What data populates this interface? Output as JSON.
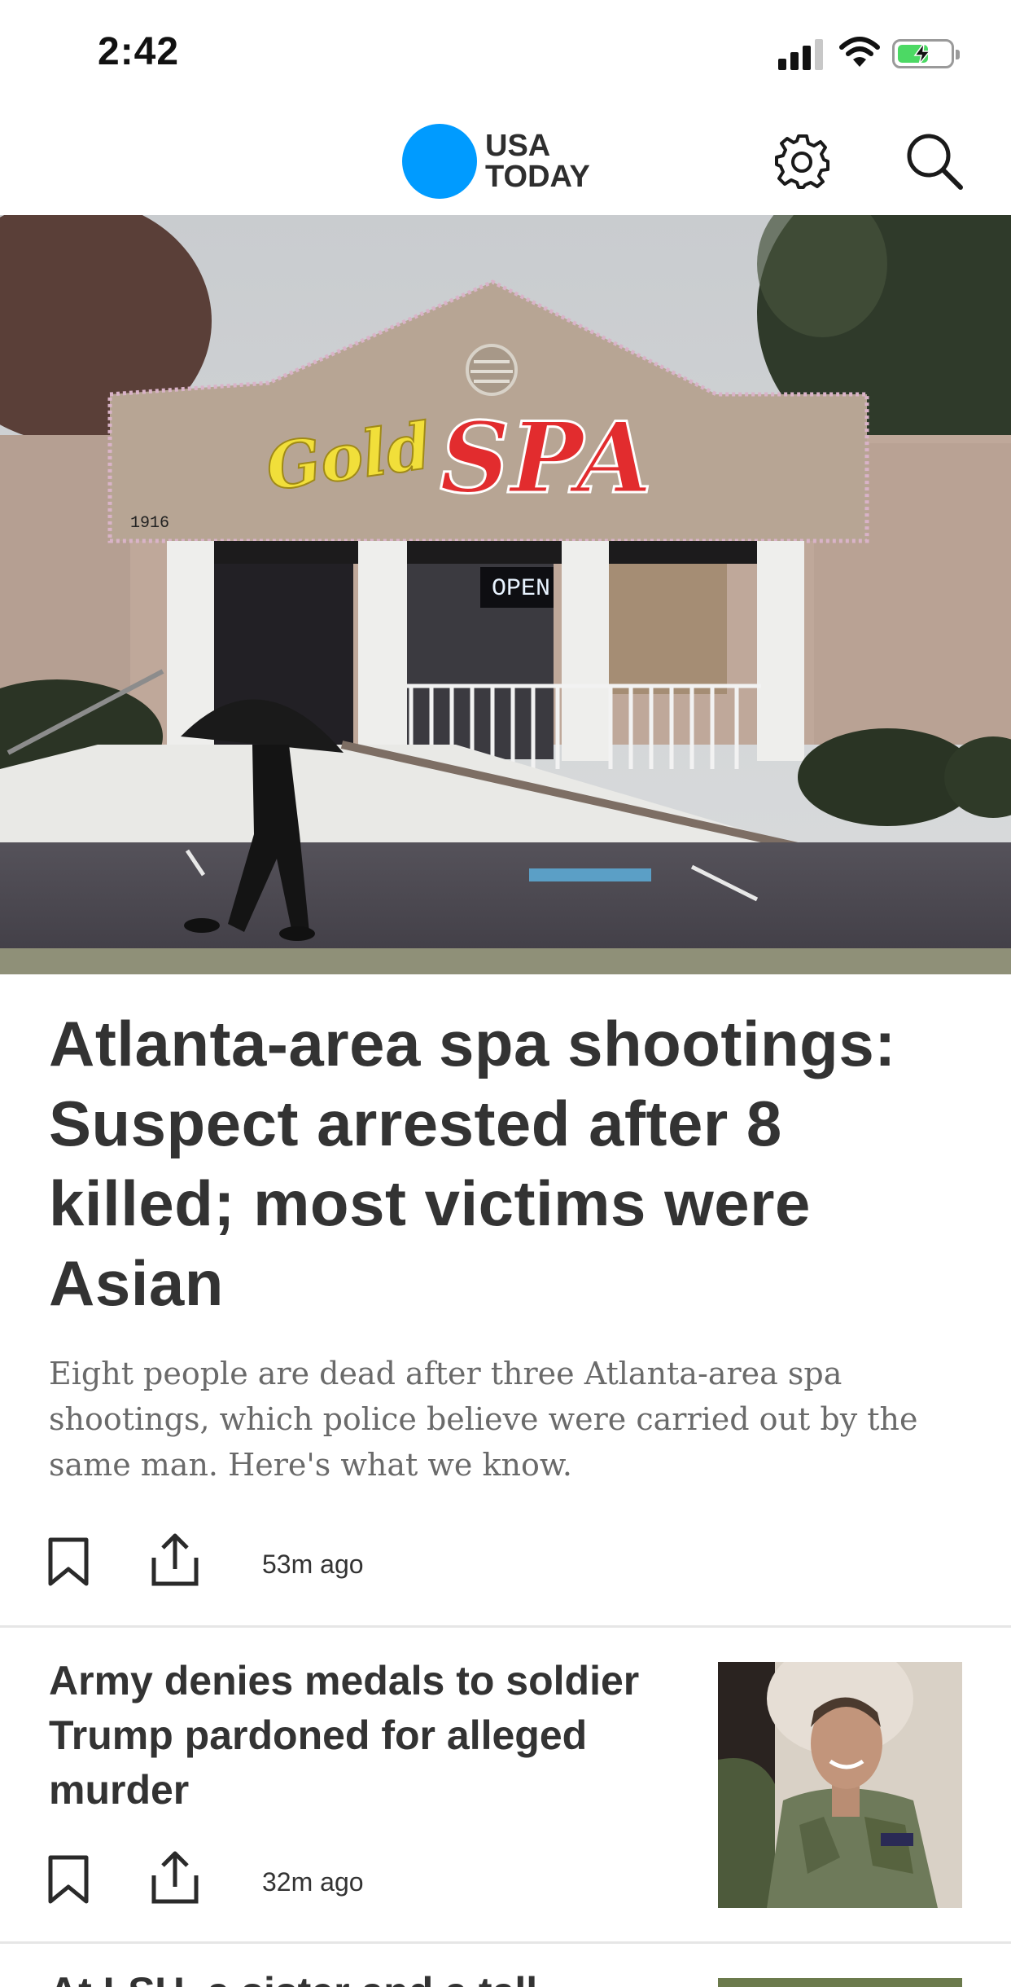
{
  "status_bar": {
    "time": "2:42",
    "battery_level": 0.6
  },
  "header": {
    "logo_line1": "USA",
    "logo_line2": "TODAY",
    "logo_color": "#009bff",
    "icons": [
      "gear-icon",
      "search-icon"
    ]
  },
  "hero": {
    "headline": "Atlanta-area spa shootings: Suspect arrested after 8 killed; most victims were Asian",
    "summary": "Eight people are dead after three Atlanta-area spa shootings, which police believe were carried out by the same man. Here's what we know.",
    "time": "53m ago",
    "photo": {
      "sign_gold": "Gold",
      "sign_spa": "SPA",
      "address": "1916",
      "open_sign": "OPEN"
    }
  },
  "stories": [
    {
      "title": "Army denies medals to soldier Trump pardoned for alleged murder",
      "time": "32m ago"
    },
    {
      "title": "At LSU, a sister and a tall"
    }
  ]
}
